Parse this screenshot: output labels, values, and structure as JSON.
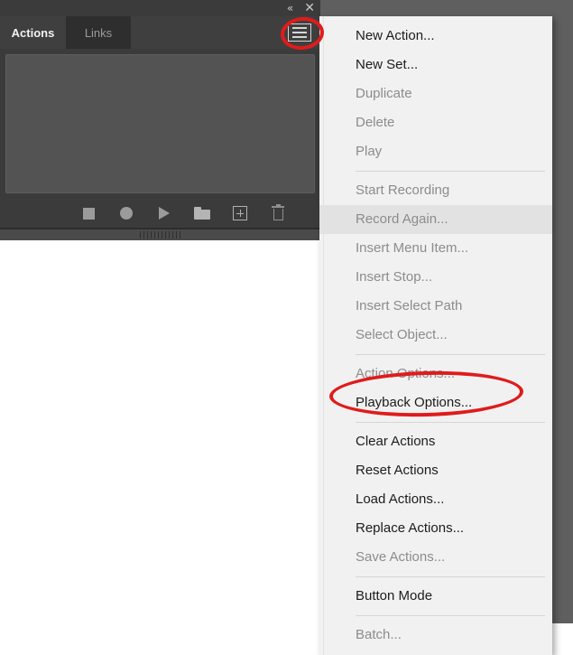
{
  "window": {
    "titlebar": {
      "collapse_icon": "double-chevron-left-icon",
      "collapse_glyph": "«",
      "close_icon": "close-icon",
      "close_glyph": "✕"
    }
  },
  "panel": {
    "tabs": [
      {
        "label": "Actions",
        "active": true
      },
      {
        "label": "Links",
        "active": false
      }
    ],
    "menu_button": {
      "name": "panel-flyout-menu-button",
      "icon": "hamburger-menu-icon"
    },
    "list_area": {
      "empty": true
    },
    "toolbar": [
      {
        "name": "stop-playing-recording-button",
        "icon": "stop-icon"
      },
      {
        "name": "begin-recording-button",
        "icon": "record-circle-icon"
      },
      {
        "name": "play-current-selection-button",
        "icon": "play-triangle-icon"
      },
      {
        "name": "create-new-set-button",
        "icon": "folder-icon"
      },
      {
        "name": "create-new-action-button",
        "icon": "new-plus-box-icon"
      },
      {
        "name": "delete-selection-button",
        "icon": "trash-icon"
      }
    ],
    "grip": {
      "name": "panel-resize-grip",
      "icon": "grip-handle-icon"
    }
  },
  "flyout_menu": {
    "groups": [
      {
        "items": [
          {
            "label": "New Action...",
            "enabled": true,
            "highlighted": false
          },
          {
            "label": "New Set...",
            "enabled": true,
            "highlighted": false
          },
          {
            "label": "Duplicate",
            "enabled": false,
            "highlighted": false
          },
          {
            "label": "Delete",
            "enabled": false,
            "highlighted": false
          },
          {
            "label": "Play",
            "enabled": false,
            "highlighted": false
          }
        ]
      },
      {
        "items": [
          {
            "label": "Start Recording",
            "enabled": false,
            "highlighted": false
          },
          {
            "label": "Record Again...",
            "enabled": false,
            "highlighted": true
          },
          {
            "label": "Insert Menu Item...",
            "enabled": false,
            "highlighted": false
          },
          {
            "label": "Insert Stop...",
            "enabled": false,
            "highlighted": false
          },
          {
            "label": "Insert Select Path",
            "enabled": false,
            "highlighted": false
          },
          {
            "label": "Select Object...",
            "enabled": false,
            "highlighted": false
          }
        ]
      },
      {
        "items": [
          {
            "label": "Action Options...",
            "enabled": false,
            "highlighted": false
          },
          {
            "label": "Playback Options...",
            "enabled": true,
            "highlighted": false
          }
        ]
      },
      {
        "items": [
          {
            "label": "Clear Actions",
            "enabled": true,
            "highlighted": false
          },
          {
            "label": "Reset Actions",
            "enabled": true,
            "highlighted": false
          },
          {
            "label": "Load Actions...",
            "enabled": true,
            "highlighted": false
          },
          {
            "label": "Replace Actions...",
            "enabled": true,
            "highlighted": false
          },
          {
            "label": "Save Actions...",
            "enabled": false,
            "highlighted": false
          }
        ]
      },
      {
        "items": [
          {
            "label": "Button Mode",
            "enabled": true,
            "highlighted": false
          }
        ]
      },
      {
        "items": [
          {
            "label": "Batch...",
            "enabled": false,
            "highlighted": false
          }
        ]
      }
    ]
  },
  "annotations": [
    {
      "name": "annotation-circle-menu-button",
      "shape": "ellipse",
      "color": "#e01b1b",
      "targets": "panel-flyout-menu-button"
    },
    {
      "name": "annotation-circle-playback-options",
      "shape": "ellipse",
      "color": "#e01b1b",
      "targets": "Playback Options..."
    }
  ],
  "colors": {
    "panel_bg": "#3b3b3b",
    "tab_active_bg": "#3f3f3f",
    "tab_inactive_bg": "#2e2e2e",
    "list_bg": "#535353",
    "desktop_bg": "#5f5f5f",
    "menu_bg": "#f1f1f1",
    "menu_highlight": "#e2e2e2",
    "annotation_red": "#e01b1b"
  }
}
